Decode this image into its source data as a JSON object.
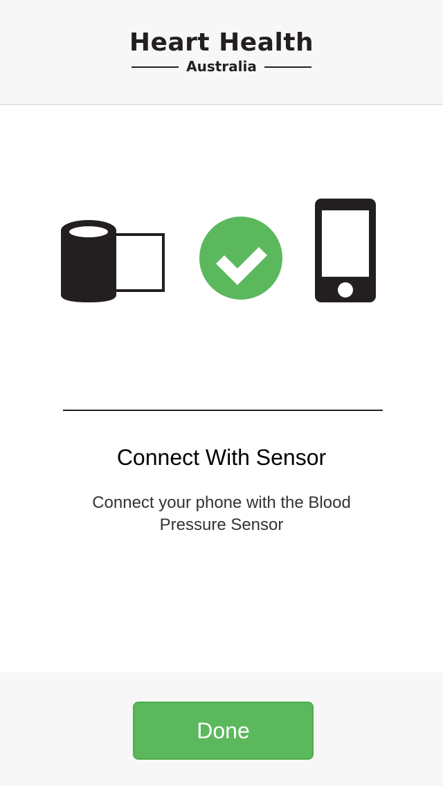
{
  "header": {
    "logo_title": "Heart Health",
    "logo_subtitle": "Australia"
  },
  "icons": {
    "sensor": "blood-pressure-sensor-icon",
    "status": "checkmark-icon",
    "phone": "smartphone-icon"
  },
  "content": {
    "title": "Connect With Sensor",
    "description": "Connect your phone with the Blood Pressure Sensor"
  },
  "footer": {
    "done_label": "Done"
  },
  "colors": {
    "accent": "#5cb85c",
    "dark": "#231f20",
    "header_bg": "#f7f7f7"
  }
}
